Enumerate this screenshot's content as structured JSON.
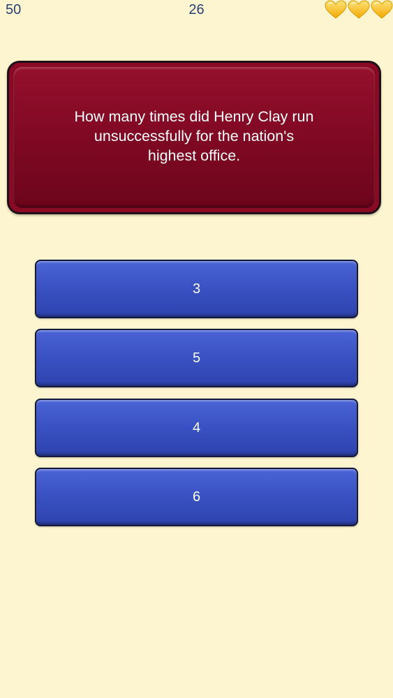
{
  "header": {
    "score_left": "50",
    "score_center": "26",
    "lives_icon": "heart-icon",
    "lives_count": 3
  },
  "question": {
    "text": "How many times did Henry Clay run unsuccessfully for the nation's highest office."
  },
  "answers": [
    {
      "label": "3"
    },
    {
      "label": "5"
    },
    {
      "label": "4"
    },
    {
      "label": "6"
    }
  ],
  "colors": {
    "background": "#fcf5cf",
    "question_card": "#8a0a26",
    "answer_button": "#3a52c4",
    "heart": "#f6c12c",
    "score_text": "#2a3f73"
  }
}
